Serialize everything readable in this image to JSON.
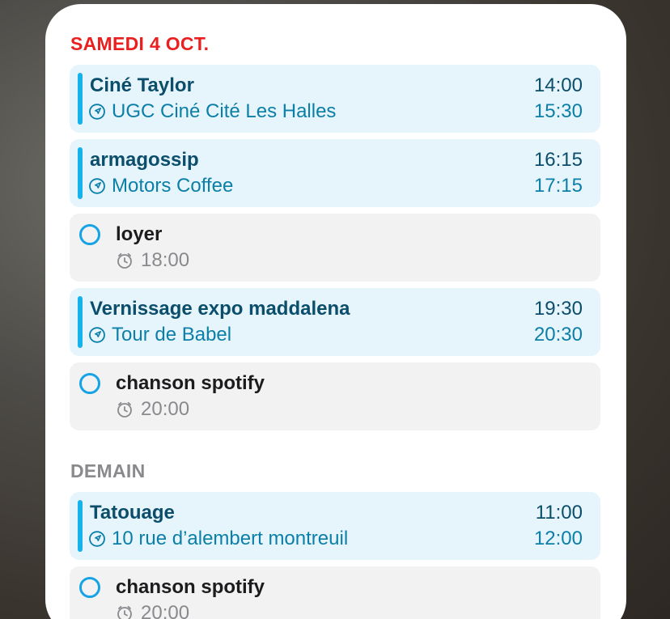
{
  "today": {
    "header": "SAMEDI 4 OCT.",
    "items": [
      {
        "kind": "event",
        "title": "Ciné Taylor",
        "location": "UGC Ciné Cité Les Halles",
        "start": "14:00",
        "end": "15:30"
      },
      {
        "kind": "event",
        "title": "armagossip",
        "location": "Motors Coffee",
        "start": "16:15",
        "end": "17:15"
      },
      {
        "kind": "reminder",
        "title": "loyer",
        "time": "18:00"
      },
      {
        "kind": "event",
        "title": "Vernissage expo maddalena",
        "location": "Tour de Babel",
        "start": "19:30",
        "end": "20:30"
      },
      {
        "kind": "reminder",
        "title": "chanson spotify",
        "time": "20:00"
      }
    ]
  },
  "tomorrow": {
    "header": "DEMAIN",
    "items": [
      {
        "kind": "event",
        "title": "Tatouage",
        "location": "10 rue d’alembert montreuil",
        "start": "11:00",
        "end": "12:00"
      },
      {
        "kind": "reminder",
        "title": "chanson spotify",
        "time": "20:00"
      }
    ]
  },
  "icons": {
    "location": "location-arrow-icon",
    "clock": "clock-icon",
    "reminder": "reminder-circle-icon"
  },
  "colors": {
    "today_header": "#ea1f1f",
    "tomorrow_header": "#8a8a8e",
    "event_background": "#e6f4fb",
    "event_accent": "#16b2ec",
    "event_title": "#0b4e6b",
    "event_location": "#0b7fa8",
    "reminder_background": "#f2f2f2",
    "reminder_circle": "#16a3e6"
  }
}
